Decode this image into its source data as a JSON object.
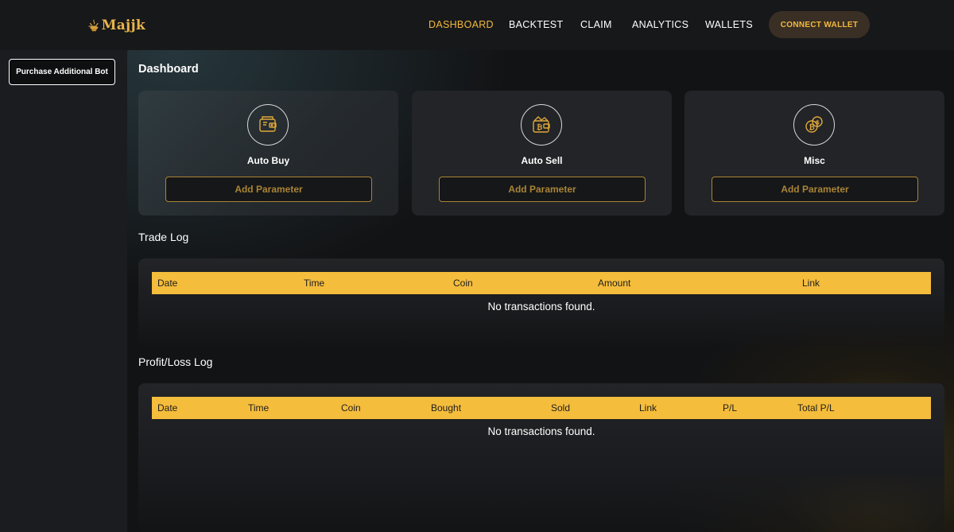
{
  "brand": {
    "name": "Majjk"
  },
  "nav": {
    "items": [
      "DASHBOARD",
      "BACKTEST",
      "CLAIM",
      "ANALYTICS",
      "WALLETS"
    ],
    "active": "DASHBOARD",
    "connect_label": "CONNECT WALLET"
  },
  "sidebar": {
    "purchase_label": "Purchase Additional Bot"
  },
  "dashboard": {
    "title": "Dashboard",
    "cards": [
      {
        "label": "Auto Buy",
        "button": "Add Parameter",
        "icon": "wallet-icon"
      },
      {
        "label": "Auto Sell",
        "button": "Add Parameter",
        "icon": "bitcoin-wallet-icon"
      },
      {
        "label": "Misc",
        "button": "Add Parameter",
        "icon": "coins-icon"
      }
    ]
  },
  "trade_log": {
    "title": "Trade Log",
    "columns": [
      "Date",
      "Time",
      "Coin",
      "Amount",
      "Link"
    ],
    "empty": "No transactions found."
  },
  "pl_log": {
    "title": "Profit/Loss Log",
    "columns": [
      "Date",
      "Time",
      "Coin",
      "Bought",
      "Sold",
      "Link",
      "P/L",
      "Total P/L"
    ],
    "empty": "No transactions found."
  },
  "colors": {
    "accent": "#f3b93c",
    "header_yellow": "#f5bd3c",
    "button_border": "#a98435",
    "background": "#111214",
    "sidebar": "#1b1c1f"
  }
}
